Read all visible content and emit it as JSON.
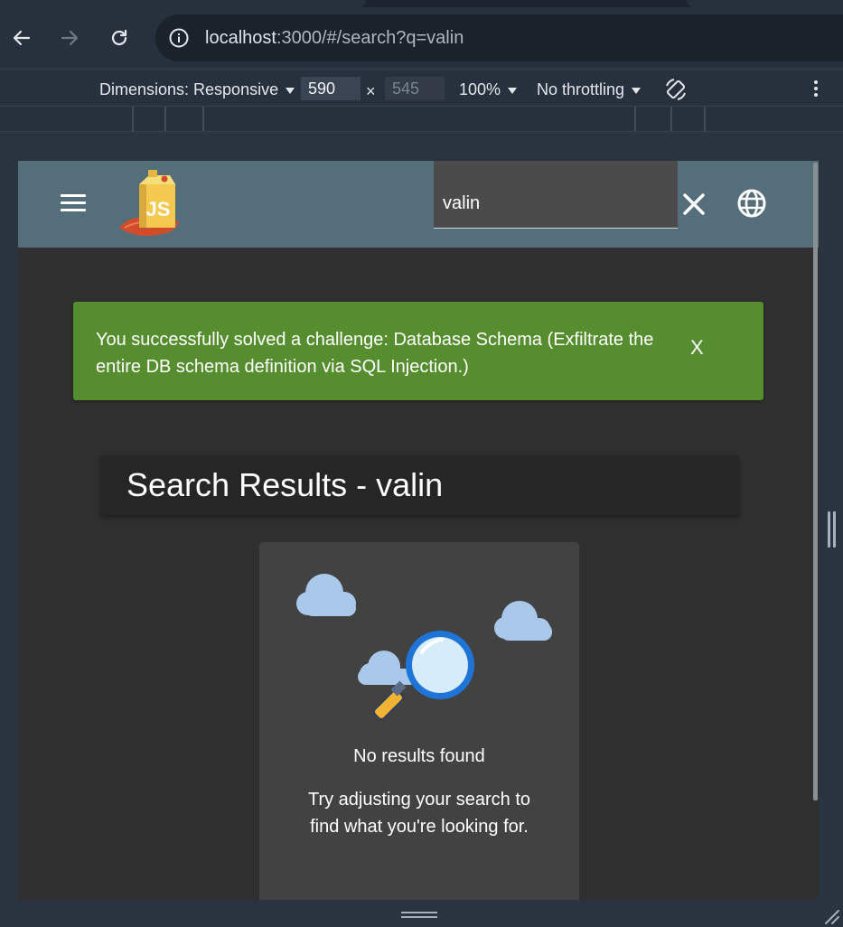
{
  "browser": {
    "url": {
      "host": "localhost",
      "rest": ":3000/#/search?q=valin"
    },
    "icons": {
      "back": "arrow-left-icon",
      "forward": "arrow-right-icon",
      "reload": "reload-icon",
      "site_info": "info-icon"
    }
  },
  "devtools": {
    "dimensions_label": "Dimensions: Responsive",
    "width_value": "590",
    "times": "×",
    "height_value": "545",
    "zoom": "100%",
    "throttling": "No throttling"
  },
  "app": {
    "search": {
      "value": "valin"
    },
    "colors": {
      "toolbar": "#546e7a",
      "snackbar": "#568e2f",
      "background": "#303030",
      "card": "#424242"
    },
    "snackbar": {
      "message": "You successfully solved a challenge: Database Schema (Exfiltrate the entire DB schema definition via SQL Injection.)",
      "close_label": "X"
    },
    "results": {
      "title": "Search Results - valin"
    },
    "empty_state": {
      "title": "No results found",
      "subtitle": "Try adjusting your search to find what you're looking for."
    }
  }
}
